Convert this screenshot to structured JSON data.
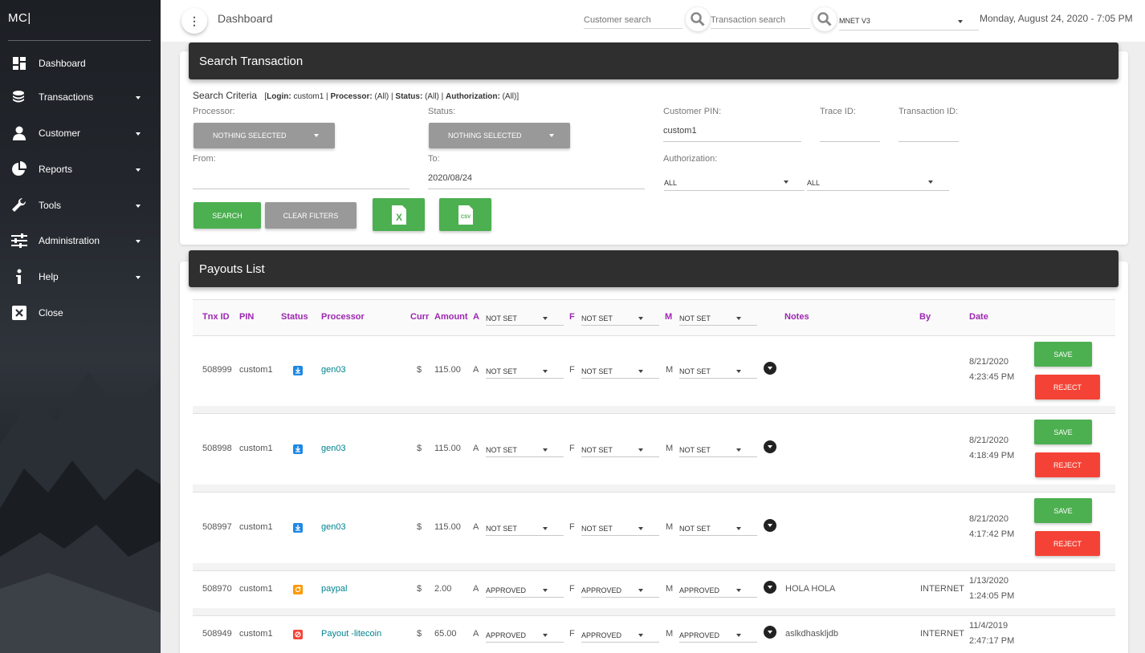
{
  "sidebar": {
    "brand": "MC|",
    "items": [
      {
        "label": "Dashboard",
        "icon": "dashboard-icon"
      },
      {
        "label": "Transactions",
        "icon": "coins-icon"
      },
      {
        "label": "Customer",
        "icon": "user-icon"
      },
      {
        "label": "Reports",
        "icon": "pie-chart-icon"
      },
      {
        "label": "Tools",
        "icon": "wrench-icon"
      },
      {
        "label": "Administration",
        "icon": "sliders-icon"
      },
      {
        "label": "Help",
        "icon": "info-icon"
      },
      {
        "label": "Close",
        "icon": "close-box-icon"
      }
    ]
  },
  "topbar": {
    "title": "Dashboard",
    "customer_search_placeholder": "Customer search",
    "transaction_search_placeholder": "Transaction search",
    "site_select": "MNET V3",
    "datetime": "Monday, August 24, 2020 - 7:05 PM"
  },
  "search": {
    "header": "Search Transaction",
    "criteria_title": "Search Criteria",
    "criteria": {
      "login_label": "Login:",
      "login_value": "custom1",
      "processor_label": "Processor:",
      "processor_value": "(All)",
      "status_label": "Status:",
      "status_value": "(All)",
      "auth_label": "Authorization:",
      "auth_value": "(All)"
    },
    "processor_label": "Processor:",
    "processor_value": "NOTHING SELECTED",
    "status_label": "Status:",
    "status_value": "NOTHING SELECTED",
    "customer_pin_label": "Customer PIN:",
    "customer_pin_value": "custom1",
    "trace_id_label": "Trace ID:",
    "transaction_id_label": "Transaction ID:",
    "from_label": "From:",
    "from_value": "",
    "to_label": "To:",
    "to_value": "2020/08/24",
    "authorization_label": "Authorization:",
    "auth_select_1": "ALL",
    "auth_select_2": "ALL",
    "search_btn": "SEARCH",
    "clear_btn": "CLEAR FILTERS",
    "excel_icon_text": "X",
    "csv_icon_text": "CSV"
  },
  "payouts": {
    "header": "Payouts List",
    "columns": {
      "tnx_id": "Tnx ID",
      "pin": "PIN",
      "status": "Status",
      "processor": "Processor",
      "curr": "Curr",
      "amount": "Amount",
      "a": "A",
      "f": "F",
      "m": "M",
      "notes": "Notes",
      "by": "By",
      "date": "Date"
    },
    "header_filters": {
      "a": "NOT SET",
      "f": "NOT SET",
      "m": "NOT SET"
    },
    "save_label": "SAVE",
    "reject_label": "REJECT",
    "rows": [
      {
        "id": "508999",
        "pin": "custom1",
        "status_icon": "download-icon",
        "status_color": "#1e88e5",
        "processor": "gen03",
        "curr": "$",
        "amount": "115.00",
        "a_label": "A",
        "a": "NOT SET",
        "f_label": "F",
        "f": "NOT SET",
        "m_label": "M",
        "m": "NOT SET",
        "notes": "",
        "by": "",
        "date": "8/21/2020",
        "time": "4:23:45 PM"
      },
      {
        "id": "508998",
        "pin": "custom1",
        "status_icon": "download-icon",
        "status_color": "#1e88e5",
        "processor": "gen03",
        "curr": "$",
        "amount": "115.00",
        "a_label": "A",
        "a": "NOT SET",
        "f_label": "F",
        "f": "NOT SET",
        "m_label": "M",
        "m": "NOT SET",
        "notes": "",
        "by": "",
        "date": "8/21/2020",
        "time": "4:18:49 PM"
      },
      {
        "id": "508997",
        "pin": "custom1",
        "status_icon": "download-icon",
        "status_color": "#1e88e5",
        "processor": "gen03",
        "curr": "$",
        "amount": "115.00",
        "a_label": "A",
        "a": "NOT SET",
        "f_label": "F",
        "f": "NOT SET",
        "m_label": "M",
        "m": "NOT SET",
        "notes": "",
        "by": "",
        "date": "8/21/2020",
        "time": "4:17:42 PM"
      },
      {
        "id": "508970",
        "pin": "custom1",
        "status_icon": "sync-icon",
        "status_color": "#ff9800",
        "processor": "paypal",
        "curr": "$",
        "amount": "2.00",
        "a_label": "A",
        "a": "APPROVED",
        "f_label": "F",
        "f": "APPROVED",
        "m_label": "M",
        "m": "APPROVED",
        "notes": "HOLA HOLA",
        "by": "INTERNET",
        "date": "1/13/2020",
        "time": "1:24:05 PM"
      },
      {
        "id": "508949",
        "pin": "custom1",
        "status_icon": "blocked-icon",
        "status_color": "#f44336",
        "processor": "Payout -litecoin",
        "curr": "$",
        "amount": "65.00",
        "a_label": "A",
        "a": "APPROVED",
        "f_label": "F",
        "f": "APPROVED",
        "m_label": "M",
        "m": "APPROVED",
        "notes": "aslkdhaskljdb",
        "by": "INTERNET",
        "date": "11/4/2019",
        "time": "2:47:17 PM"
      }
    ]
  }
}
